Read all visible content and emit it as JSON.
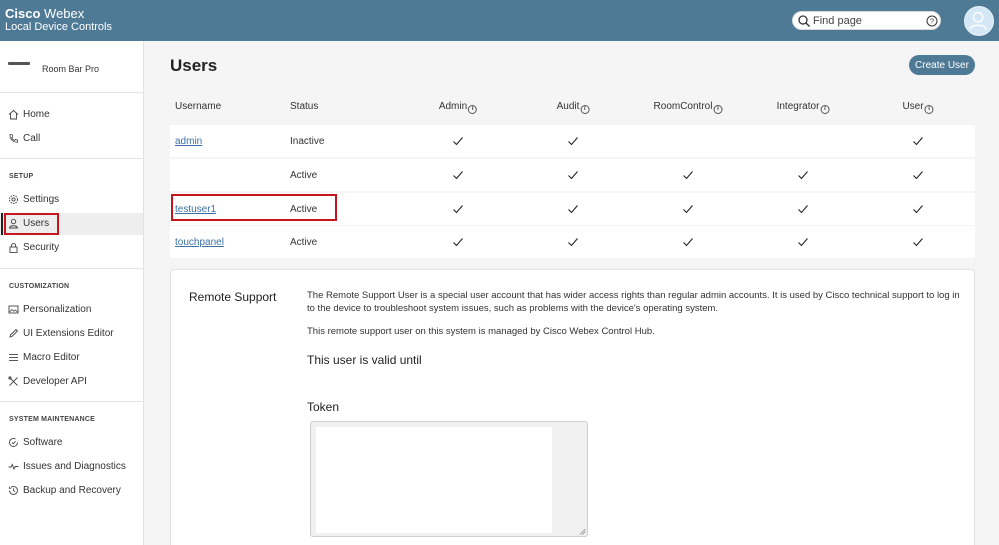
{
  "header": {
    "brand_bold": "Cisco",
    "brand_rest": "Webex",
    "subtitle": "Local Device Controls",
    "search_placeholder": "Find page"
  },
  "sidebar": {
    "device_name": "Room Bar Pro",
    "top_items": [
      {
        "label": "Home",
        "icon": "home-icon"
      },
      {
        "label": "Call",
        "icon": "phone-icon"
      }
    ],
    "sections": [
      {
        "title": "SETUP",
        "items": [
          {
            "label": "Settings",
            "icon": "gear-icon"
          },
          {
            "label": "Users",
            "icon": "user-icon",
            "active": true
          },
          {
            "label": "Security",
            "icon": "lock-icon"
          }
        ]
      },
      {
        "title": "CUSTOMIZATION",
        "items": [
          {
            "label": "Personalization",
            "icon": "image-icon"
          },
          {
            "label": "UI Extensions Editor",
            "icon": "pen-icon"
          },
          {
            "label": "Macro Editor",
            "icon": "lines-icon"
          },
          {
            "label": "Developer API",
            "icon": "tools-icon"
          }
        ]
      },
      {
        "title": "SYSTEM MAINTENANCE",
        "items": [
          {
            "label": "Software",
            "icon": "refresh-check-icon"
          },
          {
            "label": "Issues and Diagnostics",
            "icon": "pulse-icon"
          },
          {
            "label": "Backup and Recovery",
            "icon": "history-icon"
          }
        ]
      }
    ]
  },
  "main": {
    "title": "Users",
    "create_button": "Create User",
    "columns": [
      "Username",
      "Status",
      "Admin",
      "Audit",
      "RoomControl",
      "Integrator",
      "User"
    ],
    "rows": [
      {
        "username": "admin",
        "status": "Inactive",
        "roles": [
          true,
          true,
          false,
          false,
          true
        ]
      },
      {
        "username": "",
        "status": "Active",
        "roles": [
          true,
          true,
          true,
          true,
          true
        ]
      },
      {
        "username": "testuser1",
        "status": "Active",
        "roles": [
          true,
          true,
          true,
          true,
          true
        ],
        "highlighted": true
      },
      {
        "username": "touchpanel",
        "status": "Active",
        "roles": [
          true,
          true,
          true,
          true,
          true
        ]
      }
    ]
  },
  "remote_support": {
    "title": "Remote Support",
    "description": "The Remote Support User is a special user account that has wider access rights than regular admin accounts. It is used by Cisco technical support to log in to the device to troubleshoot system issues, such as problems with the device's operating system.",
    "managed_text": "This remote support user on this system is managed by Cisco Webex Control Hub.",
    "valid_until_label": "This user is valid until",
    "token_label": "Token",
    "token_value": ""
  },
  "colors": {
    "header_bg": "#4e7a96",
    "accent_button": "#4e7a96",
    "highlight_box": "#c4161c",
    "link": "#3b71a6"
  }
}
